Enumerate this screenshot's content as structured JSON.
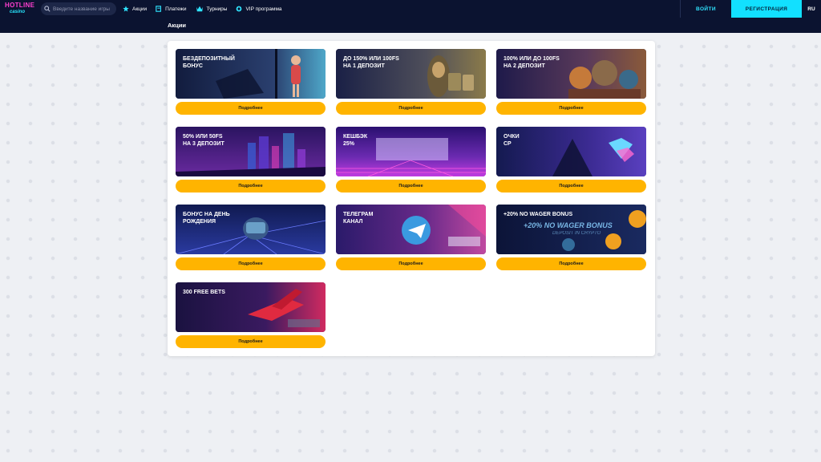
{
  "logo": {
    "line1": "HOTLINE",
    "line2": "casino"
  },
  "search": {
    "placeholder": "Введите название игры",
    "icon": "search-icon"
  },
  "nav": [
    {
      "label": "Акции",
      "icon": "star-icon",
      "color": "#2fe4ff"
    },
    {
      "label": "Платежи",
      "icon": "wallet-icon",
      "color": "#2fe4ff"
    },
    {
      "label": "Турниры",
      "icon": "trophy-icon",
      "color": "#2fe4ff"
    },
    {
      "label": "VIP программа",
      "icon": "vip-icon",
      "color": "#2fe4ff"
    }
  ],
  "auth": {
    "login_label": "ВОЙТИ",
    "register_label": "РЕГИСТРАЦИЯ"
  },
  "language": "RU",
  "page_title": "Акции",
  "promotions": [
    {
      "title": "БЕЗДЕПОЗИТНЫЙ\nБОНУС",
      "button": "Подробнее",
      "theme": "#1b2a5a"
    },
    {
      "title": "ДО 150% ИЛИ 100FS\nНА 1 ДЕПОЗИТ",
      "button": "Подробнее",
      "theme": "#2a2a4a"
    },
    {
      "title": "100% ИЛИ ДО 100FS\nНА 2 ДЕПОЗИТ",
      "button": "Подробнее",
      "theme": "#1e1a4a"
    },
    {
      "title": "50% ИЛИ 50FS\nНА 3 ДЕПОЗИТ",
      "button": "Подробнее",
      "theme": "#2a1460"
    },
    {
      "title": "КЕШБЭК\n25%",
      "button": "Подробнее",
      "theme": "#3a1680"
    },
    {
      "title": "ОЧКИ\nCP",
      "button": "Подробнее",
      "theme": "#141a50"
    },
    {
      "title": "БОНУС НА ДЕНЬ\nРОЖДЕНИЯ",
      "button": "Подробнее",
      "theme": "#1a2a70"
    },
    {
      "title": "ТЕЛЕГРАМ\nКАНАЛ",
      "button": "Подробнее",
      "theme": "#3a1a6a"
    },
    {
      "title": "+20% NO WAGER BONUS",
      "button": "Подробнее",
      "theme": "#101a40",
      "overlay": "+20% NO WAGER BONUS",
      "overlay2": "DEPOSIT IN CRYPTO"
    },
    {
      "title": "300 FREE BETS",
      "button": "Подробнее",
      "theme": "#1a1240"
    }
  ]
}
